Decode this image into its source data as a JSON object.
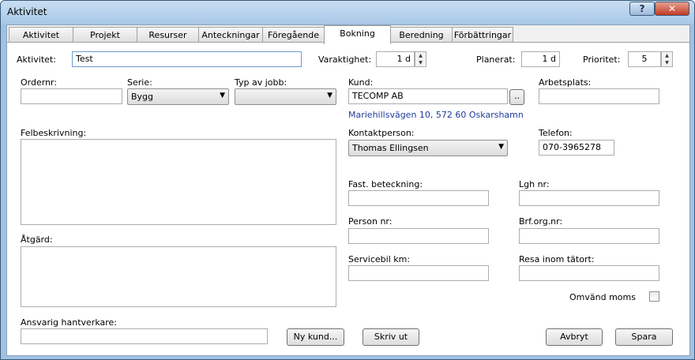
{
  "window": {
    "title": "Aktivitet",
    "help_label": "?",
    "close_label": "✕"
  },
  "tabs": [
    {
      "label": "Aktivitet",
      "active": false
    },
    {
      "label": "Projekt",
      "active": false
    },
    {
      "label": "Resurser",
      "active": false
    },
    {
      "label": "Anteckningar",
      "active": false
    },
    {
      "label": "Föregående",
      "active": false
    },
    {
      "label": "Bokning",
      "active": true
    },
    {
      "label": "Beredning",
      "active": false
    },
    {
      "label": "Förbättringar",
      "active": false
    }
  ],
  "form": {
    "aktivitet": {
      "label": "Aktivitet:",
      "value": "Test"
    },
    "varaktighet": {
      "label": "Varaktighet:",
      "value": "1 d"
    },
    "planerat": {
      "label": "Planerat:",
      "value": "1 d"
    },
    "prioritet": {
      "label": "Prioritet:",
      "value": "5"
    },
    "ordernr": {
      "label": "Ordernr:",
      "value": ""
    },
    "serie": {
      "label": "Serie:",
      "value": "Bygg"
    },
    "typ_av_jobb": {
      "label": "Typ av jobb:",
      "value": ""
    },
    "kund": {
      "label": "Kund:",
      "value": "TECOMP AB",
      "browse_label": "..",
      "address": "Mariehillsvägen 10, 572 60 Oskarshamn"
    },
    "arbetsplats": {
      "label": "Arbetsplats:",
      "value": ""
    },
    "felbeskrivning": {
      "label": "Felbeskrivning:",
      "value": ""
    },
    "kontaktperson": {
      "label": "Kontaktperson:",
      "value": "Thomas Ellingsen"
    },
    "telefon": {
      "label": "Telefon:",
      "value": "070-3965278"
    },
    "fast_beteckning": {
      "label": "Fast. beteckning:",
      "value": ""
    },
    "lgh_nr": {
      "label": "Lgh nr:",
      "value": ""
    },
    "person_nr": {
      "label": "Person nr:",
      "value": ""
    },
    "brf_org_nr": {
      "label": "Brf.org.nr:",
      "value": ""
    },
    "atgard": {
      "label": "Åtgärd:",
      "value": ""
    },
    "servicebil_km": {
      "label": "Servicebil km:",
      "value": ""
    },
    "resa_inom_tatort": {
      "label": "Resa inom tätort:",
      "value": ""
    },
    "omvand_moms": {
      "label": "Omvänd moms",
      "checked": false
    },
    "ansvarig_hantverkare": {
      "label": "Ansvarig hantverkare:",
      "value": ""
    }
  },
  "buttons": {
    "ny_kund": "Ny kund...",
    "skriv_ut": "Skriv ut",
    "avbryt": "Avbryt",
    "spara": "Spara"
  }
}
